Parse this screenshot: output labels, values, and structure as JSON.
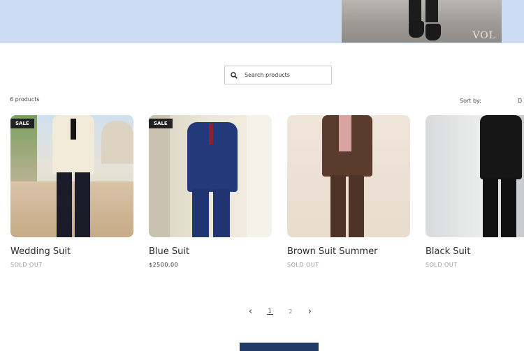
{
  "hero": {
    "logo_text": "VOL"
  },
  "search": {
    "placeholder": "Search products"
  },
  "collection": {
    "count_label": "6 products",
    "sort_label": "Sort by:",
    "sort_value": "D"
  },
  "products": [
    {
      "title": "Wedding Suit",
      "price": "SOLD OUT",
      "badge": "SALE"
    },
    {
      "title": "Blue Suit",
      "price": "$2500.00",
      "badge": "SALE"
    },
    {
      "title": "Brown Suit Summer",
      "price": "SOLD OUT",
      "badge": ""
    },
    {
      "title": "Black Suit",
      "price": "SOLD OUT",
      "badge": ""
    }
  ],
  "pagination": {
    "prev": "‹",
    "current": "1",
    "next_page": "2",
    "next": "›"
  },
  "colors": {
    "hero_bg": "#cddcf3",
    "cta_bg": "#1f3a64",
    "badge_bg": "#222222"
  }
}
